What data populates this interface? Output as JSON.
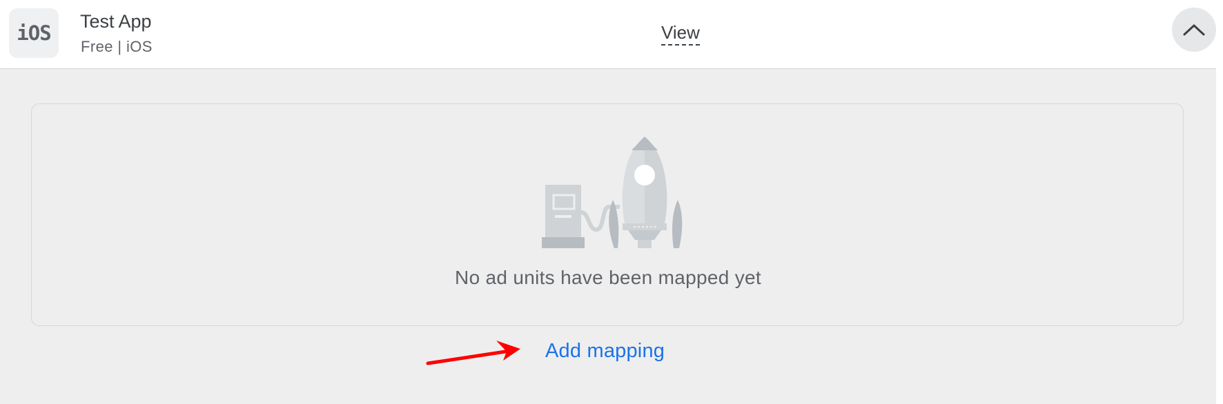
{
  "app": {
    "icon_label": "iOS",
    "name": "Test App",
    "meta": "Free | iOS"
  },
  "header": {
    "view_label": "View",
    "collapse_icon": "chevron-up-icon"
  },
  "empty_state": {
    "illustration": "rocket-fuel-station-illustration",
    "message": "No ad units have been mapped yet"
  },
  "actions": {
    "add_mapping_label": "Add mapping"
  },
  "annotation": {
    "arrow_color": "#ff0000"
  },
  "colors": {
    "link": "#1a73e8",
    "background": "#eeeeee",
    "header_background": "#ffffff"
  }
}
